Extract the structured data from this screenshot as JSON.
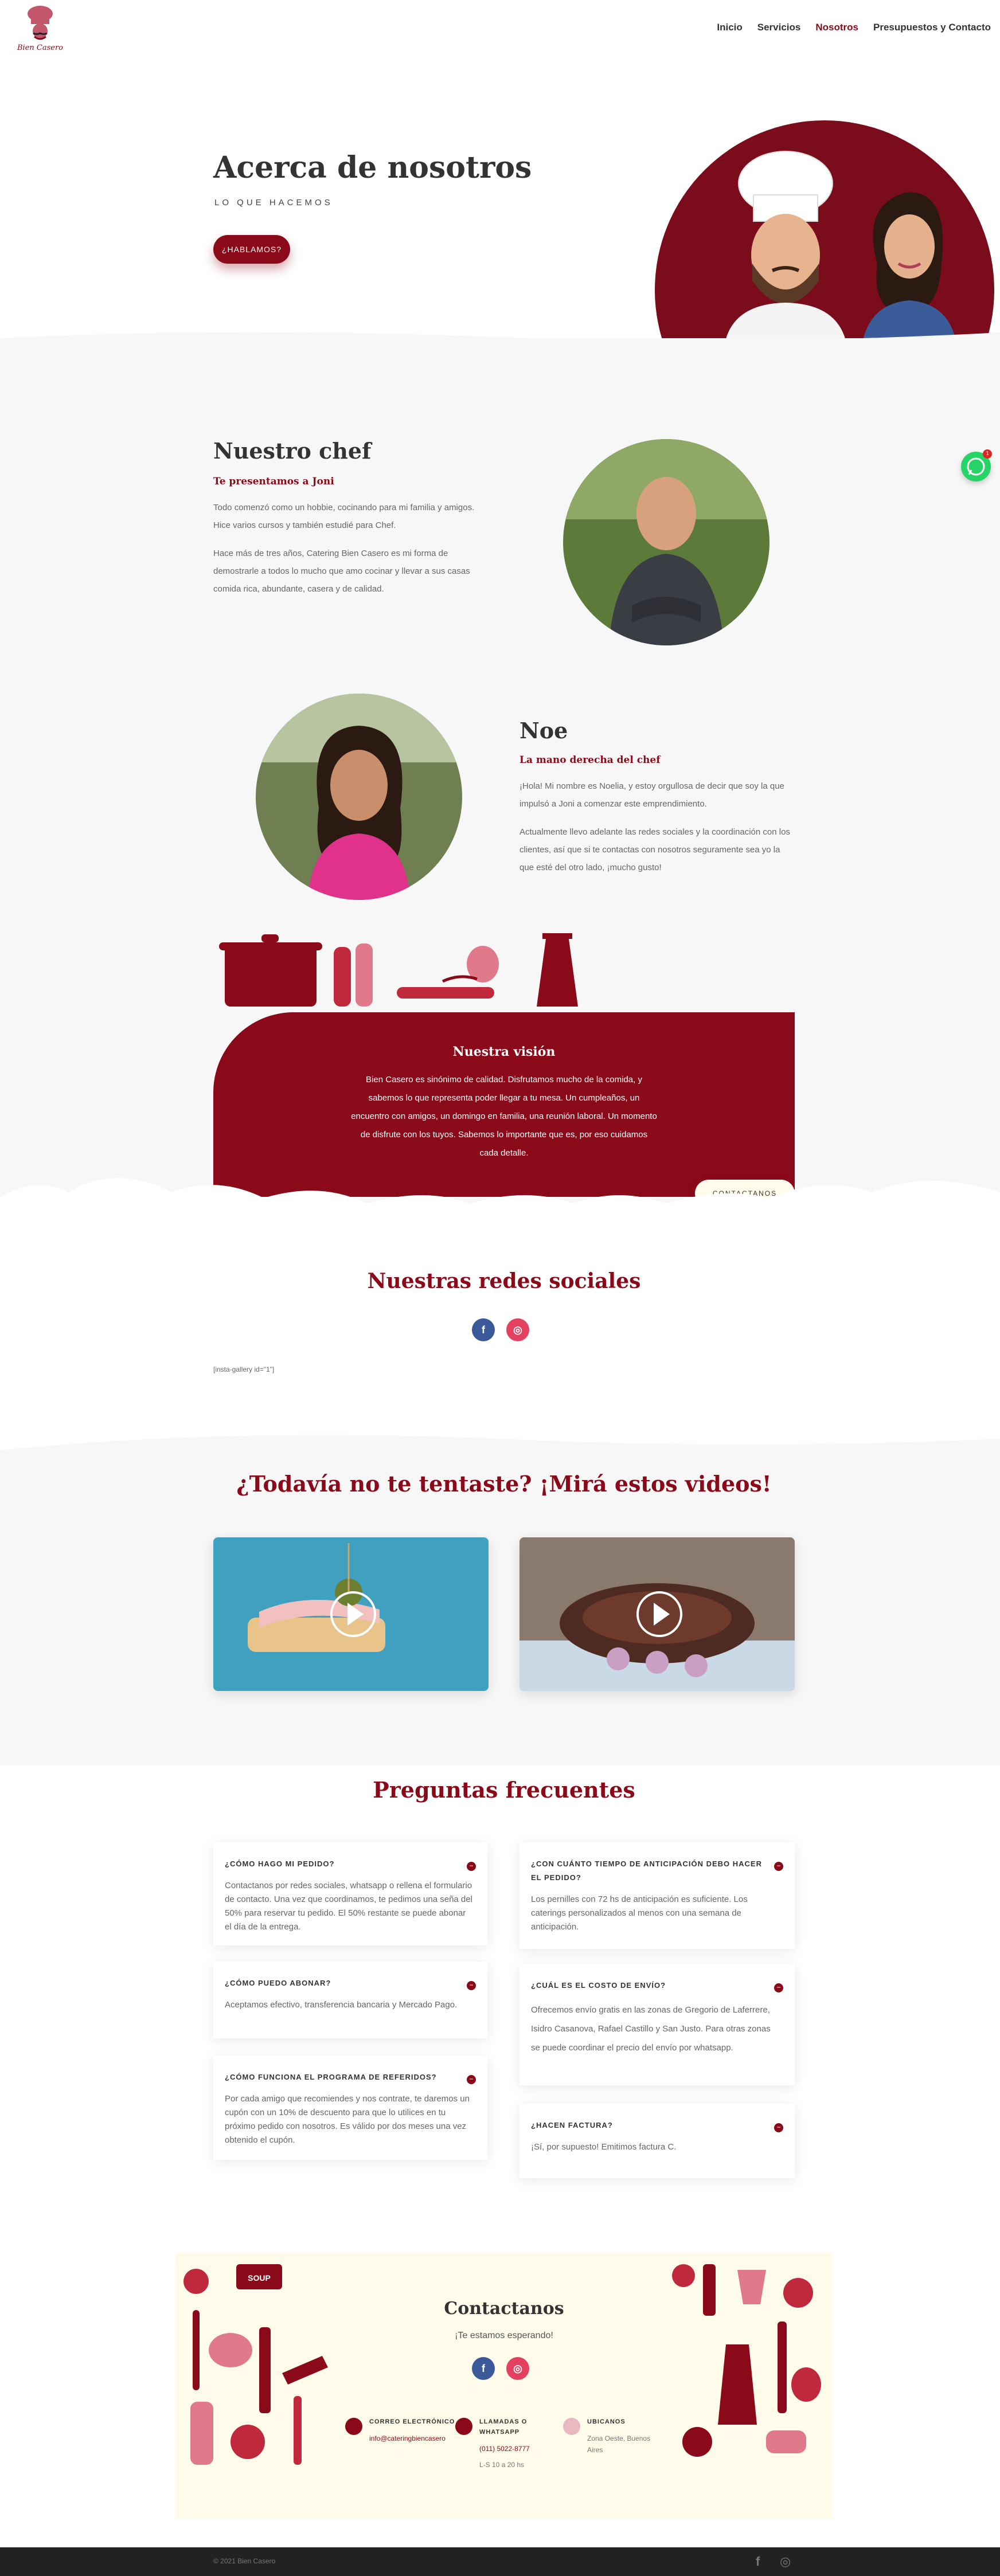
{
  "brand": {
    "logo_text": "Bien Casero"
  },
  "nav": {
    "items": [
      "Inicio",
      "Servicios",
      "Nosotros",
      "Presupuestos y Contacto"
    ],
    "active": "Nosotros"
  },
  "hero": {
    "title": "Acerca de nosotros",
    "subtitle": "LO QUE HACEMOS",
    "cta": "¿HABLAMOS?"
  },
  "chef": {
    "title": "Nuestro chef",
    "kicker": "Te presentamos a Joni",
    "p1": "Todo comenzó como un hobbie, cocinando para mi familia y amigos. Hice varios cursos y también estudié para Chef.",
    "p2": "Hace más de tres años, Catering Bien Casero es mi forma de demostrarle a todos lo mucho que amo cocinar y llevar a sus casas comida rica, abundante, casera y de calidad."
  },
  "noe": {
    "title": "Noe",
    "kicker": "La mano derecha del chef",
    "p1": "¡Hola! Mi nombre es Noelia, y estoy orgullosa de decir que soy la que impulsó a Joni a comenzar este emprendimiento.",
    "p2": "Actualmente llevo adelante las redes sociales y la coordinación con los clientes, así que si te contactas con nosotros seguramente sea yo la que esté del otro lado, ¡mucho gusto!"
  },
  "whatsapp": {
    "badge": "1"
  },
  "vision": {
    "title": "Nuestra visión",
    "text": "Bien Casero es sinónimo de calidad. Disfrutamos mucho de la comida, y sabemos lo que representa poder llegar a tu mesa. Un cumpleaños, un encuentro con amigos, un domingo en familia, una reunión laboral. Un momento de disfrute con los tuyos. Sabemos lo importante que es, por eso cuidamos cada detalle.",
    "button": "CONTACTANOS"
  },
  "social": {
    "title": "Nuestras redes sociales",
    "shortcode": "[insta-gallery id=\"1\"]",
    "facebook": "f",
    "instagram": "◎"
  },
  "videos": {
    "title": "¿Todavía no te tentaste? ¡Mirá estos videos!"
  },
  "faq": {
    "title": "Preguntas frecuentes",
    "left": [
      {
        "q": "¿CÓMO HAGO MI PEDIDO?",
        "a": "Contactanos por redes sociales, whatsapp o rellena el formulario de contacto. Una vez que coordinamos, te pedimos una seña del 50% para reservar tu pedido. El 50% restante se puede abonar el día de la entrega."
      },
      {
        "q": "¿CÓMO PUEDO ABONAR?",
        "a": "Aceptamos efectivo, transferencia bancaria y Mercado Pago."
      },
      {
        "q": "¿CÓMO FUNCIONA EL PROGRAMA DE REFERIDOS?",
        "a": "Por cada amigo que recomiendes y nos contrate, te daremos un cupón con un 10% de descuento para que lo utilices en tu próximo pedido con nosotros. Es válido por dos meses una vez obtenido el cupón."
      }
    ],
    "right": [
      {
        "q": "¿CON CUÁNTO TIEMPO DE ANTICIPACIÓN DEBO HACER EL PEDIDO?",
        "a": "Los pernilles con 72 hs de anticipación es suficiente. Los caterings personalizados al menos con una semana de anticipación."
      },
      {
        "q": "¿CUÁL ES EL COSTO DE ENVÍO?",
        "a": "Ofrecemos envío gratis en las zonas de Gregorio de Laferrere, Isidro Casanova, Rafael Castillo y San Justo. Para otras zonas se puede coordinar el precio del envío por whatsapp."
      },
      {
        "q": "¿HACEN FACTURA?",
        "a": "¡Sí, por supuesto! Emitimos factura C."
      }
    ]
  },
  "contact": {
    "title": "Contactanos",
    "subtitle": "¡Te estamos esperando!",
    "soup_label": "SOUP",
    "email_head": "CORREO ELECTRÓNICO",
    "email": "info@cateringbiencasero",
    "phone_head": "LLAMADAS O WHATSAPP",
    "phone": "(011) 5022-8777",
    "hours": "L-S 10 a 20 hs",
    "location_head": "UBICANOS",
    "location": "Zona Oeste, Buenos Aires"
  },
  "footer": {
    "copyright": "© 2021 Bien Casero",
    "facebook": "f",
    "instagram": "◎"
  },
  "colors": {
    "brand_red": "#8b0a1a",
    "cream": "#fffbea",
    "facebook_blue": "#3b5998",
    "instagram_pink": "#e4405f",
    "whatsapp_green": "#25d366"
  }
}
